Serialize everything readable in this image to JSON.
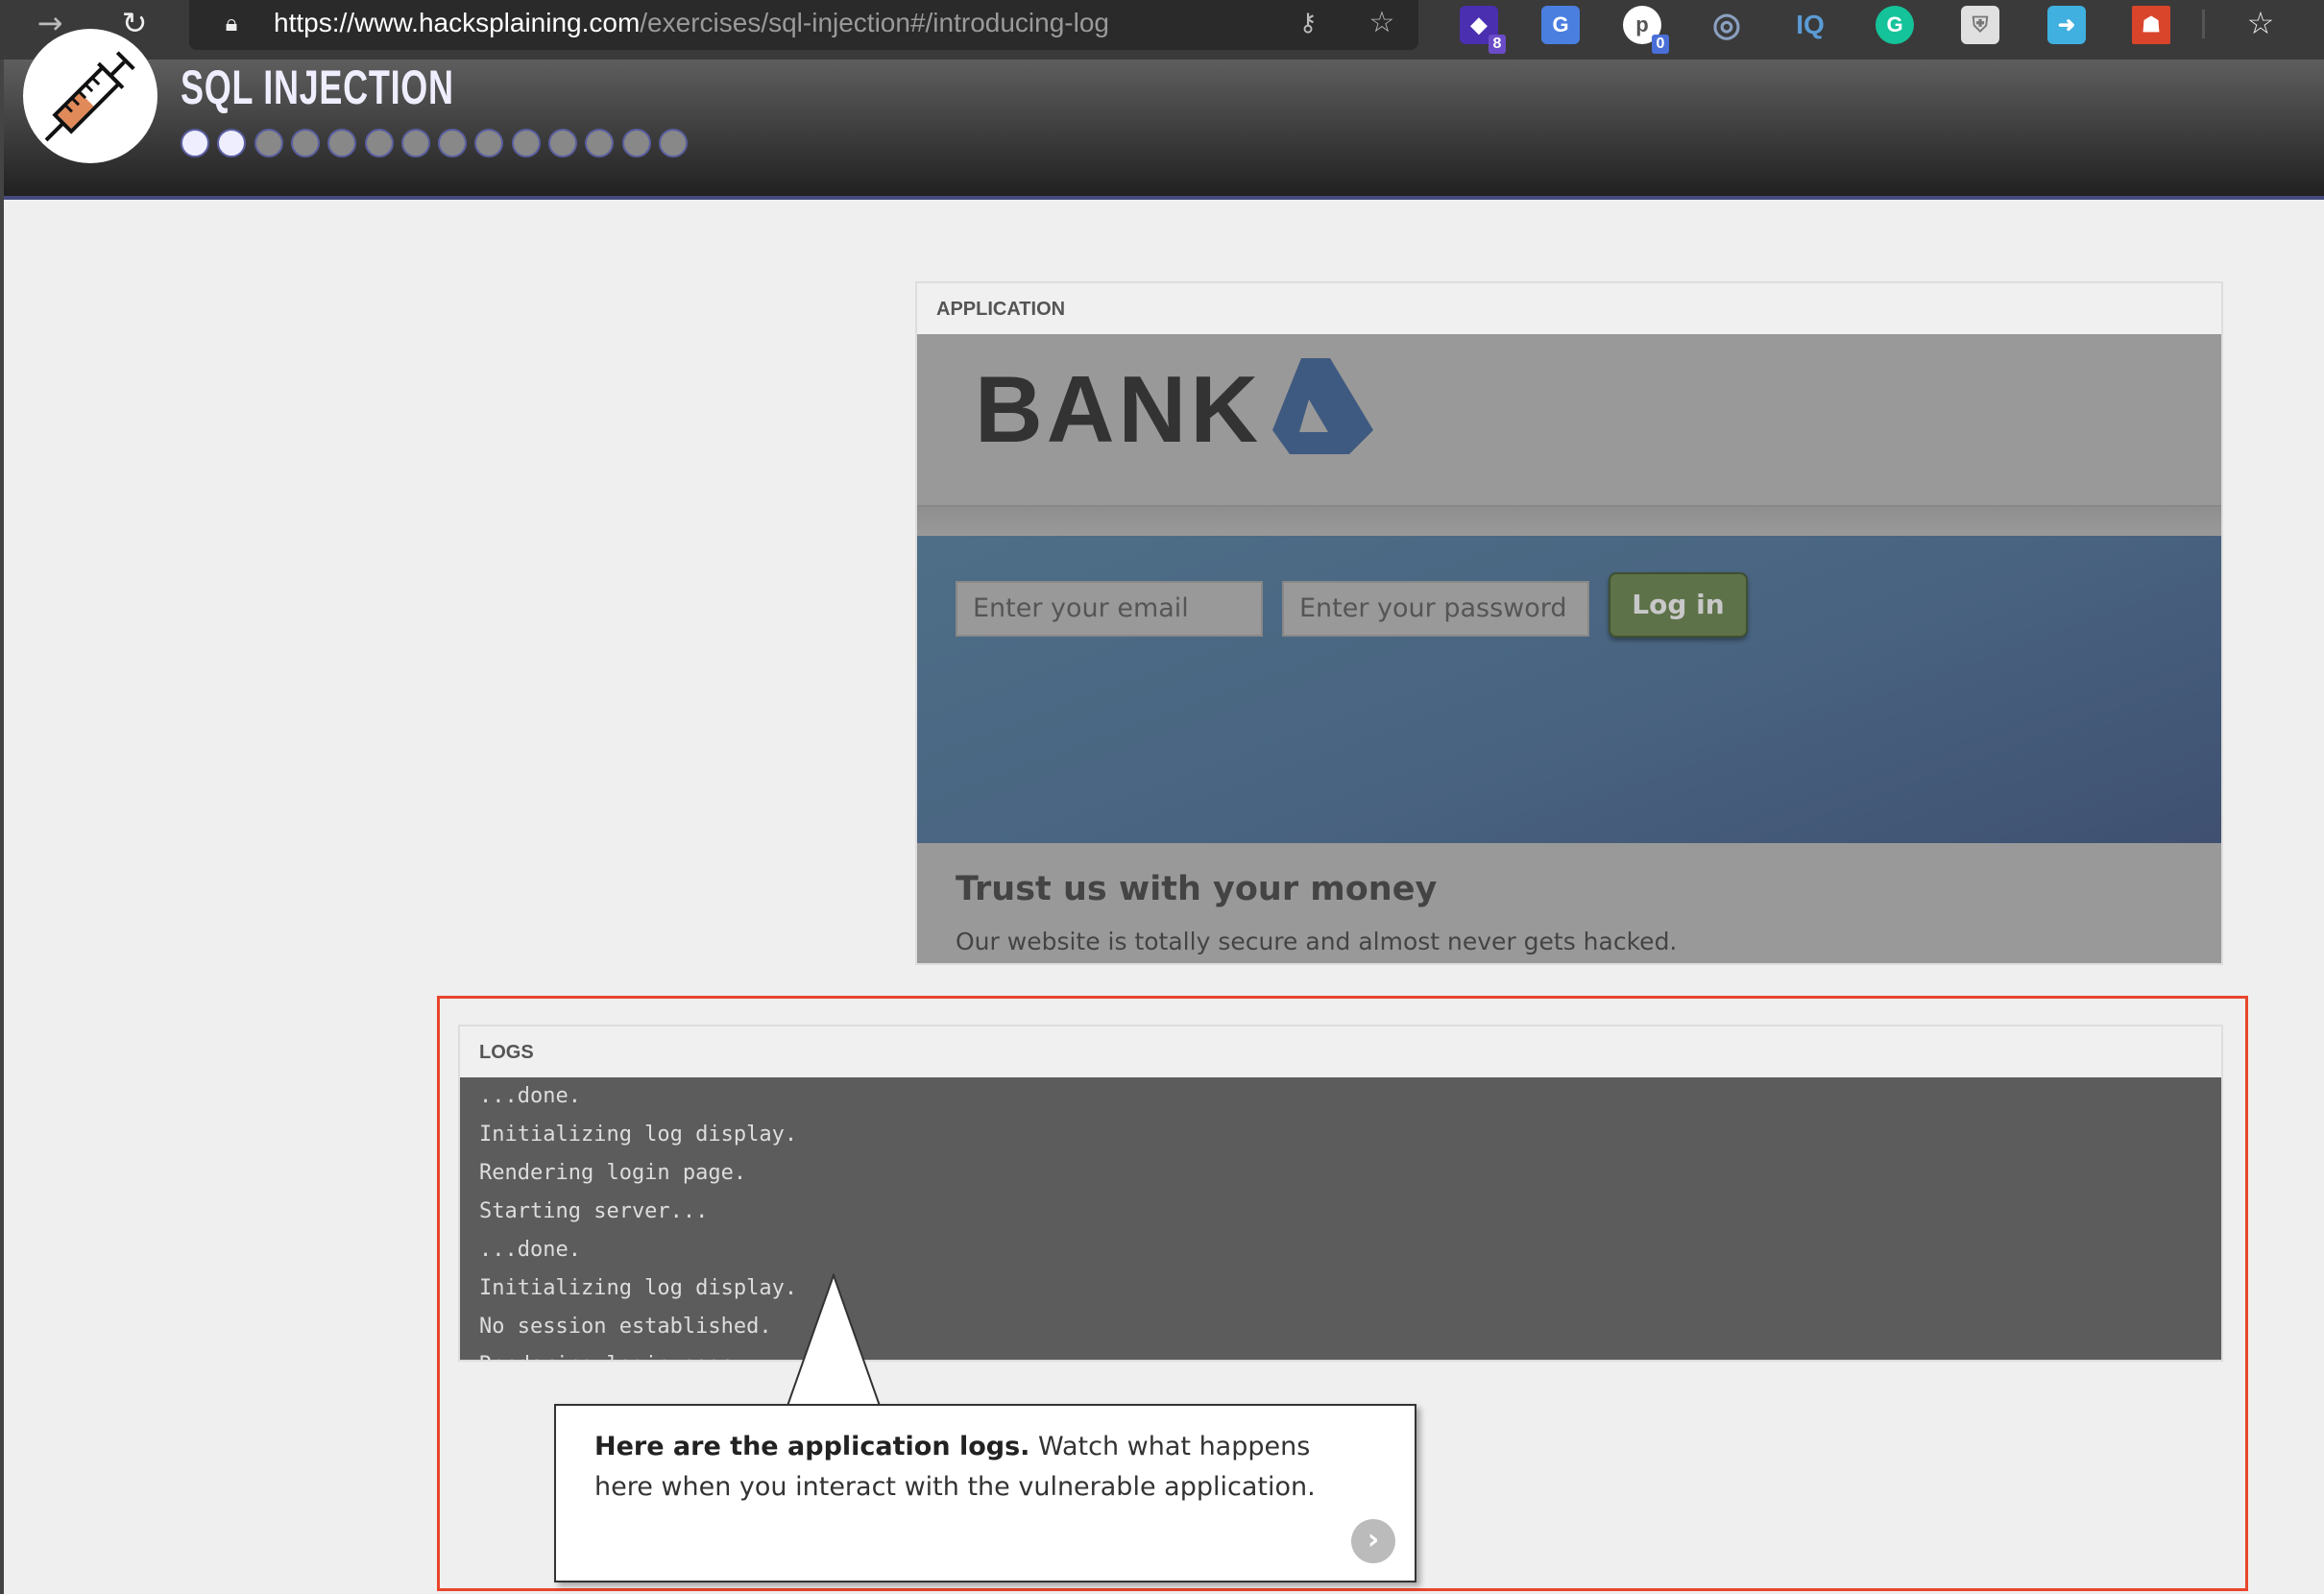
{
  "browser": {
    "url_host": "https://www.hacksplaining.com",
    "url_path": "/exercises/sql-injection#/introducing-log",
    "extensions": [
      {
        "name": "stacks-extension",
        "badge": "8",
        "color": "#4a2fb0"
      },
      {
        "name": "google-translate-extension",
        "color": "#4a7fe0"
      },
      {
        "name": "p-extension",
        "badge": "0",
        "color": "#ffffff"
      },
      {
        "name": "ring-extension",
        "color": "#8aa0c0"
      },
      {
        "name": "iq-extension",
        "label": "IQ",
        "color": "#5b9bd5"
      },
      {
        "name": "grammarly-extension",
        "label": "G",
        "color": "#15c39a"
      },
      {
        "name": "shield-extension",
        "color": "#e0e0e0"
      },
      {
        "name": "arrow-extension",
        "color": "#3fb0e0"
      },
      {
        "name": "red-extension",
        "color": "#d9452b"
      }
    ]
  },
  "header": {
    "title": "SQL INJECTION",
    "progress": {
      "completed": 2,
      "total": 14
    }
  },
  "application": {
    "label": "APPLICATION",
    "brand": "BANK",
    "email_placeholder": "Enter your email",
    "password_placeholder": "Enter your password",
    "login_label": "Log in",
    "tagline": "Trust us with your money",
    "subtitle": "Our website is totally secure and almost never gets hacked."
  },
  "logs": {
    "label": "LOGS",
    "lines": [
      "...done.",
      "Initializing log display.",
      "Rendering login page.",
      "Starting server...",
      "...done.",
      "Initializing log display.",
      "No session established.",
      "Rendering login page."
    ]
  },
  "tooltip": {
    "bold": "Here are the application logs.",
    "text": " Watch what happens here when you interact with the vulnerable application."
  },
  "colors": {
    "highlight": "#e8452c",
    "hero_blue": "#4e6e87",
    "login_green": "#5d7249"
  }
}
